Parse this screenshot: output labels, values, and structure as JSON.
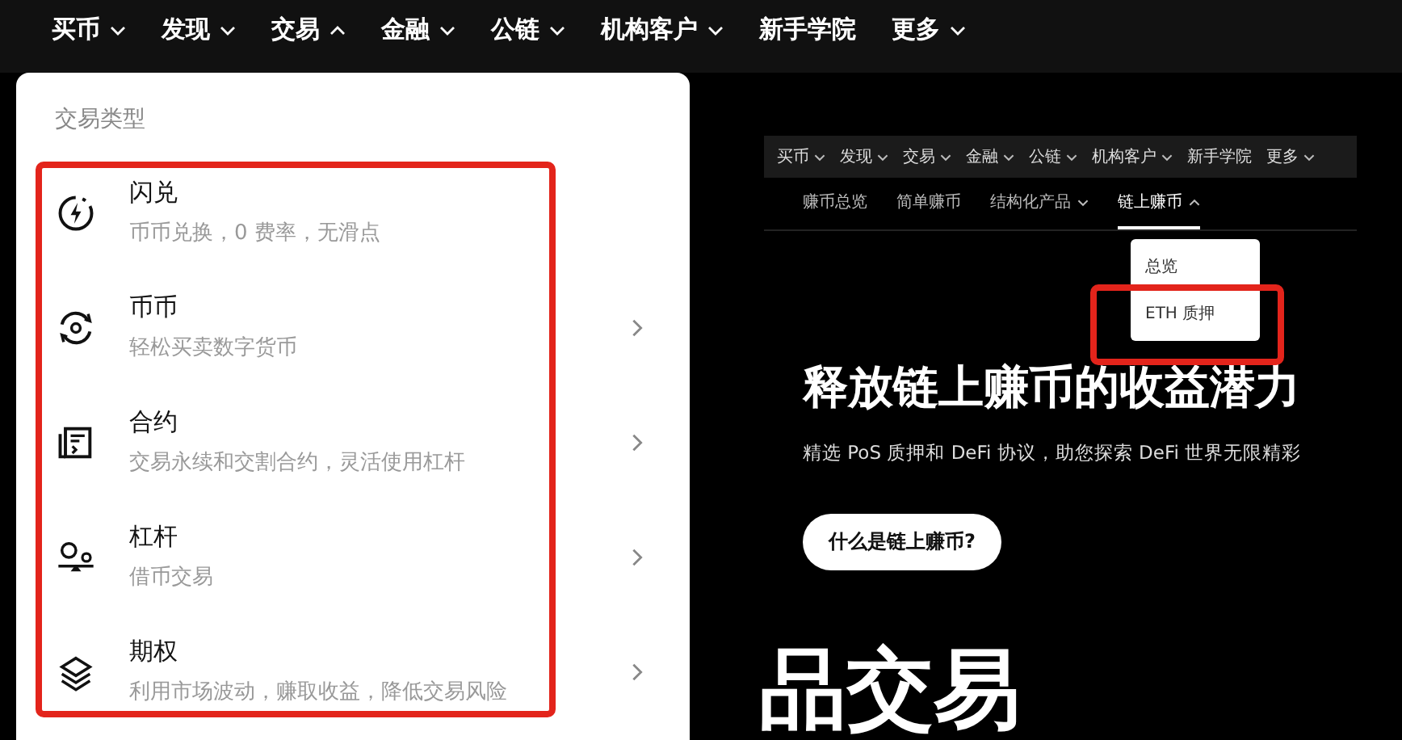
{
  "top_nav": [
    {
      "label": "买币",
      "dropdown": true,
      "expanded": false
    },
    {
      "label": "发现",
      "dropdown": true,
      "expanded": false
    },
    {
      "label": "交易",
      "dropdown": true,
      "expanded": true
    },
    {
      "label": "金融",
      "dropdown": true,
      "expanded": false
    },
    {
      "label": "公链",
      "dropdown": true,
      "expanded": false
    },
    {
      "label": "机构客户",
      "dropdown": true,
      "expanded": false
    },
    {
      "label": "新手学院",
      "dropdown": false
    },
    {
      "label": "更多",
      "dropdown": true,
      "expanded": false
    }
  ],
  "trade_menu": {
    "heading": "交易类型",
    "items": [
      {
        "kind": "flash",
        "title": "闪兑",
        "description": "币币兑换，0 费率，无滑点",
        "has_submenu": false
      },
      {
        "kind": "spot",
        "title": "币币",
        "description": "轻松买卖数字货币",
        "has_submenu": true
      },
      {
        "kind": "contract",
        "title": "合约",
        "description": "交易永续和交割合约，灵活使用杠杆",
        "has_submenu": true
      },
      {
        "kind": "margin",
        "title": "杠杆",
        "description": "借币交易",
        "has_submenu": true
      },
      {
        "kind": "options",
        "title": "期权",
        "description": "利用市场波动，赚取收益，降低交易风险",
        "has_submenu": true
      }
    ]
  },
  "embedded_page": {
    "nav": [
      {
        "label": "买币",
        "dropdown": true
      },
      {
        "label": "发现",
        "dropdown": true
      },
      {
        "label": "交易",
        "dropdown": true
      },
      {
        "label": "金融",
        "dropdown": true
      },
      {
        "label": "公链",
        "dropdown": true
      },
      {
        "label": "机构客户",
        "dropdown": true
      },
      {
        "label": "新手学院",
        "dropdown": false
      },
      {
        "label": "更多",
        "dropdown": true
      }
    ],
    "sub_nav": [
      {
        "label": "赚币总览",
        "dropdown": false,
        "selected": false
      },
      {
        "label": "简单赚币",
        "dropdown": false,
        "selected": false
      },
      {
        "label": "结构化产品",
        "dropdown": true,
        "selected": false
      },
      {
        "label": "链上赚币",
        "dropdown": true,
        "selected": true
      }
    ],
    "sub_menu": [
      "总览",
      "ETH 质押"
    ],
    "title": "释放链上赚币的收益潜力",
    "subtitle": "精选 PoS 质押和 DeFi 协议，助您探索 DeFi 世界无限精彩",
    "button": "什么是链上赚币?"
  },
  "backdrop_text": "品交易"
}
